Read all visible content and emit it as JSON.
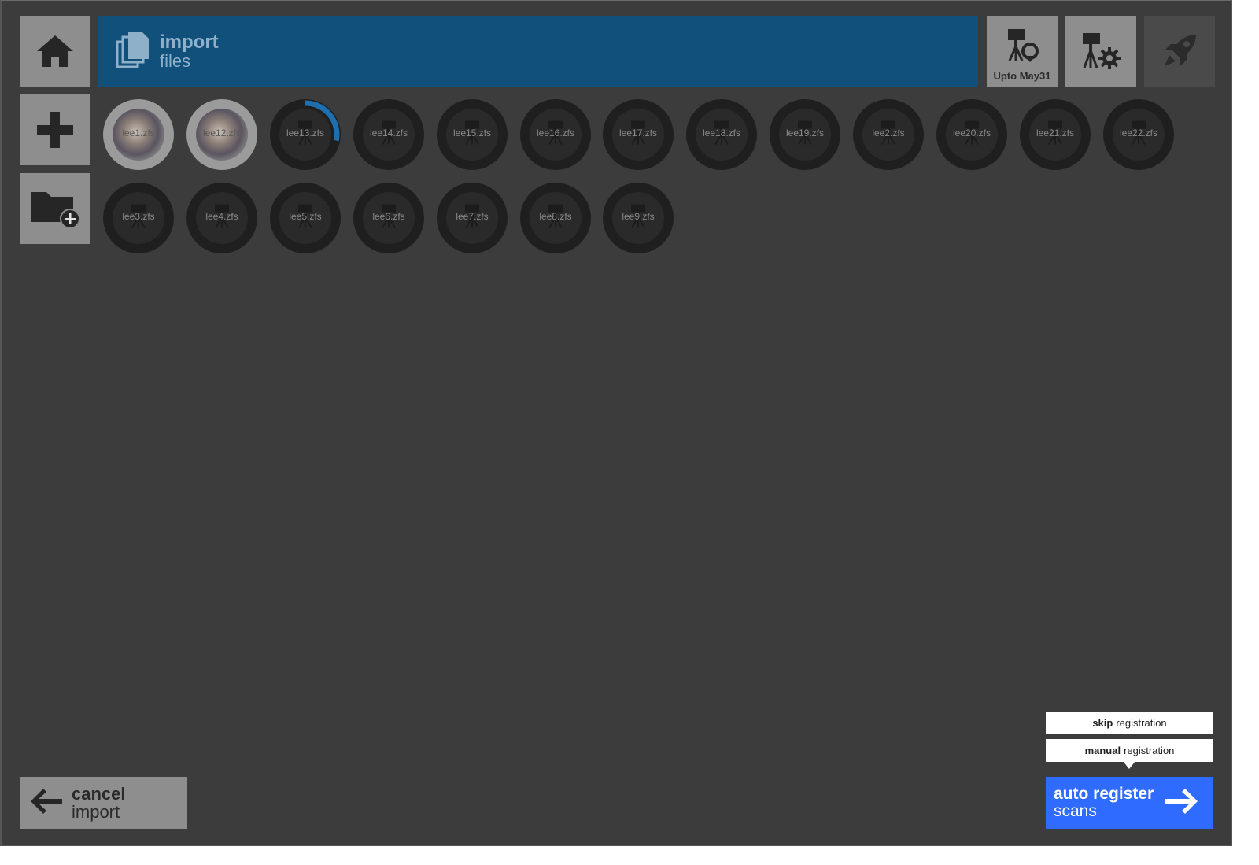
{
  "header": {
    "title": "import",
    "subtitle": "files",
    "project_tile_label": "Upto May31"
  },
  "scans_row1": [
    {
      "name": "lee1.zfs",
      "state": "loaded"
    },
    {
      "name": "lee12.zfs",
      "state": "loaded"
    },
    {
      "name": "lee13.zfs",
      "state": "loading",
      "progress": 0.28
    },
    {
      "name": "lee14.zfs",
      "state": "pending"
    },
    {
      "name": "lee15.zfs",
      "state": "pending"
    },
    {
      "name": "lee16.zfs",
      "state": "pending"
    },
    {
      "name": "lee17.zfs",
      "state": "pending"
    },
    {
      "name": "lee18.zfs",
      "state": "pending"
    },
    {
      "name": "lee19.zfs",
      "state": "pending"
    },
    {
      "name": "lee2.zfs",
      "state": "pending"
    },
    {
      "name": "lee20.zfs",
      "state": "pending"
    },
    {
      "name": "lee21.zfs",
      "state": "pending"
    },
    {
      "name": "lee22.zfs",
      "state": "pending"
    }
  ],
  "scans_row2": [
    {
      "name": "lee3.zfs",
      "state": "pending"
    },
    {
      "name": "lee4.zfs",
      "state": "pending"
    },
    {
      "name": "lee5.zfs",
      "state": "pending"
    },
    {
      "name": "lee6.zfs",
      "state": "pending"
    },
    {
      "name": "lee7.zfs",
      "state": "pending"
    },
    {
      "name": "lee8.zfs",
      "state": "pending"
    },
    {
      "name": "lee9.zfs",
      "state": "pending"
    }
  ],
  "actions": {
    "cancel_main": "cancel",
    "cancel_sub": "import",
    "skip_bold": "skip",
    "skip_rest": "registration",
    "manual_bold": "manual",
    "manual_rest": "registration",
    "auto_main": "auto register",
    "auto_sub": "scans"
  },
  "colors": {
    "title_bar": "#10507a",
    "accent_blue": "#2f6bff",
    "progress": "#1e6fb0",
    "background": "#3c3c3c",
    "tile": "#8e8e8e"
  }
}
